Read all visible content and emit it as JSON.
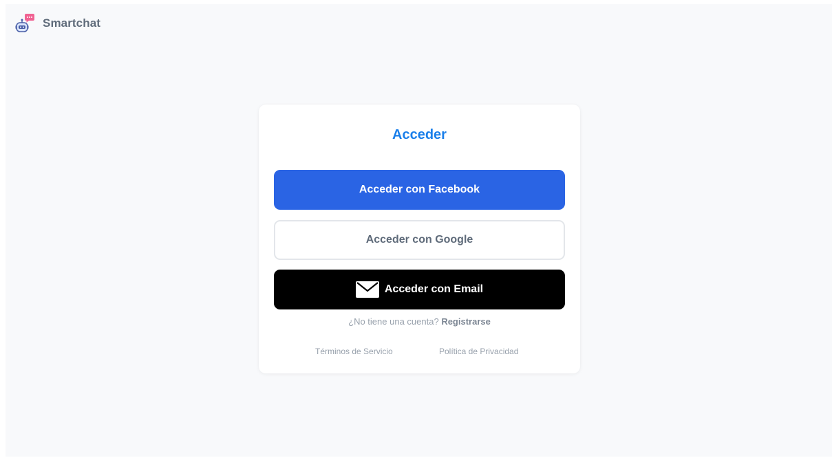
{
  "brand": {
    "name": "Smartchat",
    "logo_icon": "robot-chat-icon"
  },
  "login": {
    "title": "Acceder",
    "facebook_label": "Acceder con Facebook",
    "google_label": "Acceder con Google",
    "email_label": "Acceder con Email",
    "email_icon": "envelope-icon",
    "signup_prompt": "¿No tiene una cuenta?",
    "signup_link": "Registrarse",
    "terms_link": "Términos de Servicio",
    "privacy_link": "Política de Privacidad"
  },
  "colors": {
    "title": "#1a7fea",
    "facebook": "#2a64e4",
    "email": "#000000",
    "background": "#f8f9fb"
  }
}
